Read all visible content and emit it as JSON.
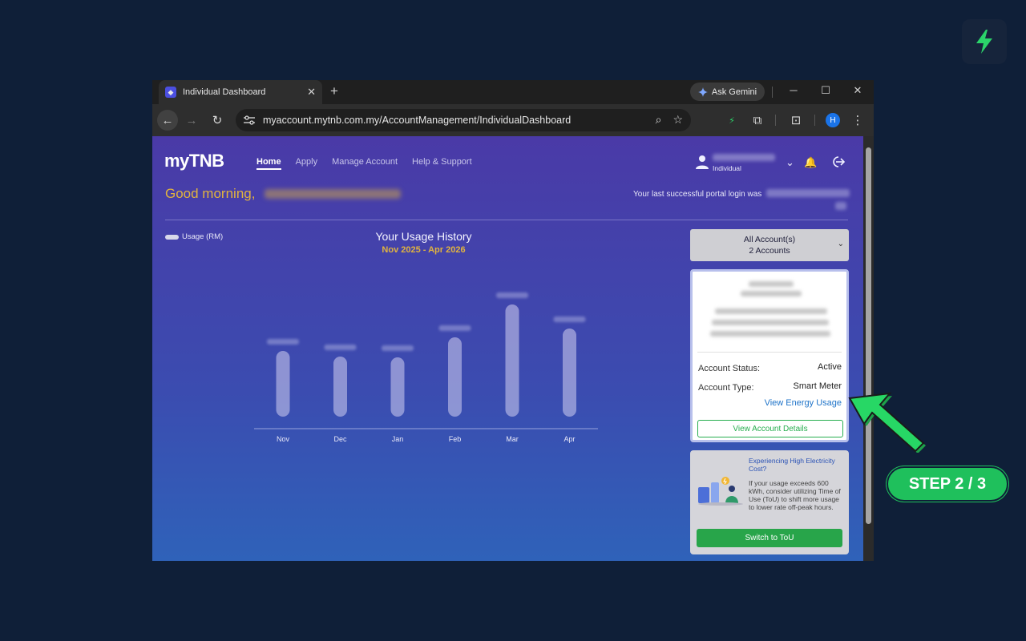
{
  "browser": {
    "tab_title": "Individual Dashboard",
    "new_tab": "+",
    "gemini_label": "Ask Gemini",
    "url": "myaccount.mytnb.com.my/AccountManagement/IndividualDashboard",
    "profile_initial": "H"
  },
  "site": {
    "logo": "myTNB",
    "nav": [
      "Home",
      "Apply",
      "Manage Account",
      "Help & Support"
    ],
    "user_type": "Individual",
    "greeting": "Good morning,",
    "last_login_label": "Your last successful portal login was"
  },
  "chart_data": {
    "type": "bar",
    "title": "Your Usage History",
    "subtitle": "Nov 2025 - Apr 2026",
    "legend": "Usage (RM)",
    "categories": [
      "Nov",
      "Dec",
      "Jan",
      "Feb",
      "Mar",
      "Apr"
    ],
    "values": [
      82,
      75,
      74,
      99,
      140,
      110
    ],
    "ylim": [
      0,
      150
    ],
    "grid": false
  },
  "accounts": {
    "selector_title": "All Account(s)",
    "selector_count": "2 Accounts",
    "status_label": "Account Status:",
    "status_value": "Active",
    "type_label": "Account Type:",
    "type_value": "Smart Meter",
    "view_energy": "View Energy Usage",
    "view_details": "View Account Details"
  },
  "tou": {
    "title": "Experiencing High Electricity Cost?",
    "body": "If your usage exceeds 600 kWh, consider utilizing Time of Use (ToU) to shift more usage to lower rate off-peak hours.",
    "button": "Switch to ToU"
  },
  "overlay": {
    "step": "STEP 2 / 3"
  },
  "colors": {
    "accent_green": "#1fc05c",
    "gold": "#e1b33f",
    "link_blue": "#1e73c8"
  }
}
